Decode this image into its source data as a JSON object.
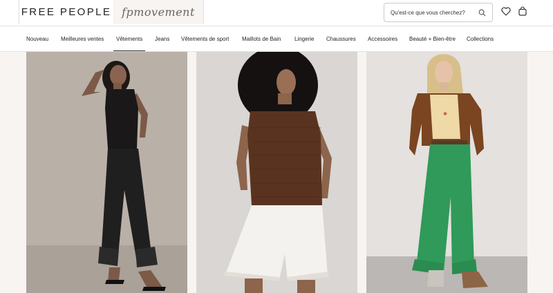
{
  "header": {
    "logo": "FREE PEOPLE",
    "secondary_logo": "fpmovement",
    "search_placeholder": "Qu'est-ce que vous cherchez?",
    "icons": [
      "search-icon",
      "heart-icon",
      "bag-icon"
    ]
  },
  "nav": {
    "items": [
      {
        "label": "Nouveau"
      },
      {
        "label": "Meilleures ventes"
      },
      {
        "label": "Vêtements",
        "active": true
      },
      {
        "label": "Jeans"
      },
      {
        "label": "Vêtements de sport"
      },
      {
        "label": "Maillots de Bain"
      },
      {
        "label": "Lingerie"
      },
      {
        "label": "Chaussures"
      },
      {
        "label": "Accessoires"
      },
      {
        "label": "Beauté + Bien-être"
      },
      {
        "label": "Collections"
      }
    ]
  },
  "products": [
    {
      "image": "black lace cami with black lace-trim bloomer pants",
      "background": "#b9b0a8"
    },
    {
      "image": "brown crochet tank with white denim shorts",
      "background": "#d9d6d3"
    },
    {
      "image": "brown suede jacket, yellow graphic tee, green wide-leg pants",
      "background": "#e4e1de"
    }
  ],
  "colors": {
    "page_bg": "#f7f4f1",
    "header_bg": "#ffffff",
    "text": "#222222",
    "border": "#e6e1dc"
  }
}
